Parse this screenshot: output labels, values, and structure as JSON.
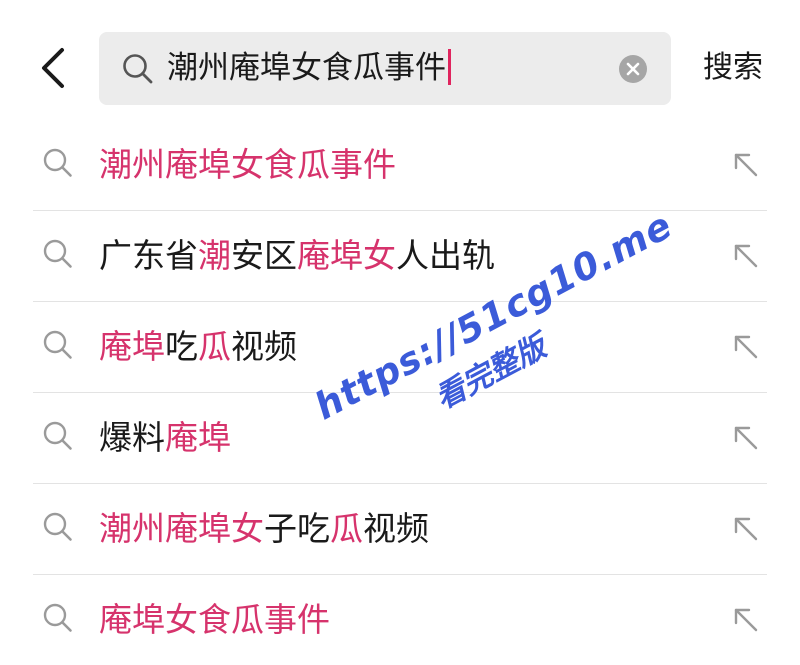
{
  "search": {
    "query": "潮州庵埠女食瓜事件",
    "submit_label": "搜索"
  },
  "suggestions": [
    {
      "segments": [
        {
          "text": "潮州庵埠女食瓜事件",
          "highlight": true
        }
      ]
    },
    {
      "segments": [
        {
          "text": "广东省",
          "highlight": false
        },
        {
          "text": "潮",
          "highlight": true
        },
        {
          "text": "安区",
          "highlight": false
        },
        {
          "text": "庵埠女",
          "highlight": true
        },
        {
          "text": "人出轨",
          "highlight": false
        }
      ]
    },
    {
      "segments": [
        {
          "text": "庵埠",
          "highlight": true
        },
        {
          "text": "吃",
          "highlight": false
        },
        {
          "text": "瓜",
          "highlight": true
        },
        {
          "text": "视频",
          "highlight": false
        }
      ]
    },
    {
      "segments": [
        {
          "text": "爆料",
          "highlight": false
        },
        {
          "text": "庵埠",
          "highlight": true
        }
      ]
    },
    {
      "segments": [
        {
          "text": "潮州庵埠女",
          "highlight": true
        },
        {
          "text": "子吃",
          "highlight": false
        },
        {
          "text": "瓜",
          "highlight": true
        },
        {
          "text": "视频",
          "highlight": false
        }
      ]
    },
    {
      "segments": [
        {
          "text": "庵埠女食瓜事件",
          "highlight": true
        }
      ]
    }
  ],
  "watermark": {
    "line1": "https://51cg10.me",
    "line2": "看完整版"
  },
  "colors": {
    "highlight": "#d6336c",
    "caret": "#e0245e",
    "search_bg": "#ececec",
    "watermark": "#3b5bd9"
  },
  "icons": {
    "back": "chevron-left-icon",
    "search": "search-icon",
    "clear": "clear-circle-icon",
    "fill": "arrow-up-left-icon"
  }
}
